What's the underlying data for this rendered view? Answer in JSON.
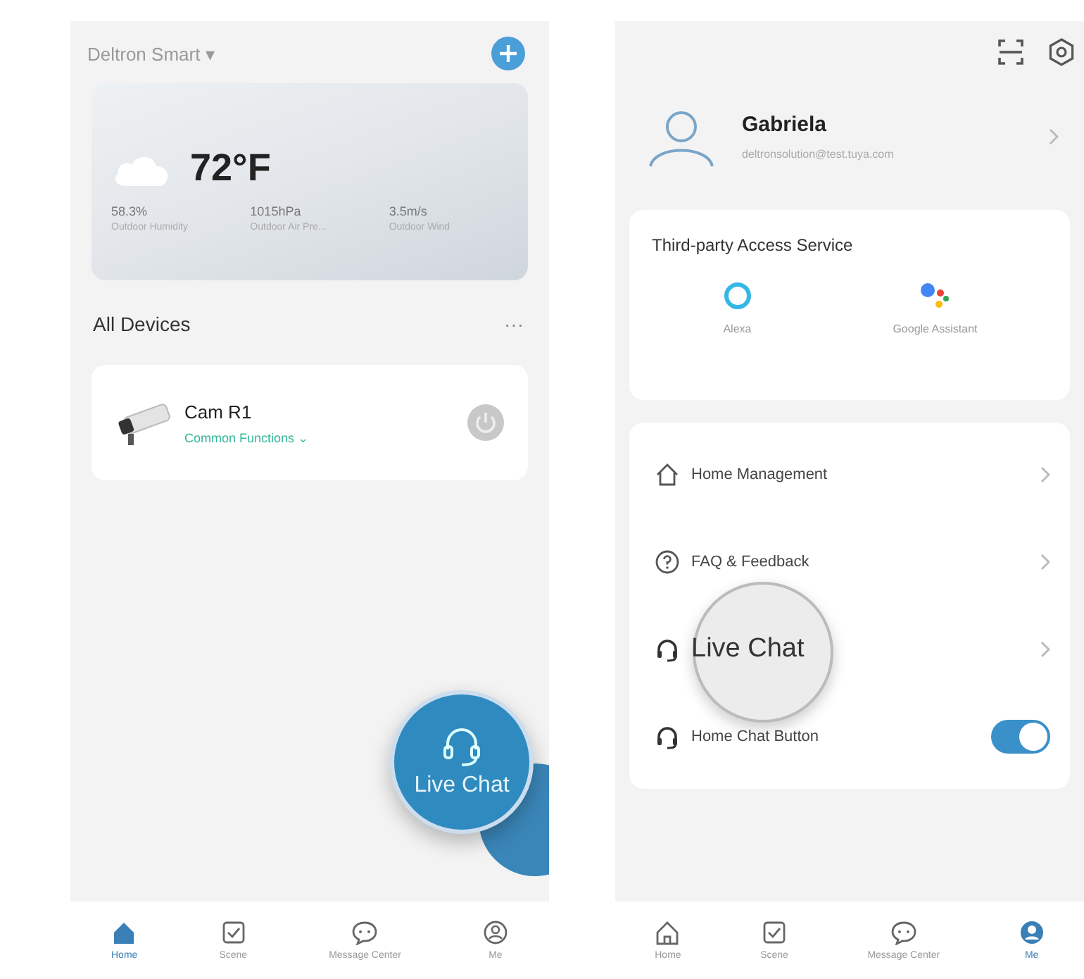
{
  "home_screen": {
    "home_name": "Deltron Smart ▾",
    "weather": {
      "temperature": "72°F",
      "stats": [
        {
          "value": "58.3%",
          "label": "Outdoor Humidity"
        },
        {
          "value": "1015hPa",
          "label": "Outdoor Air Pre..."
        },
        {
          "value": "3.5m/s",
          "label": "Outdoor Wind"
        }
      ]
    },
    "section_title": "All Devices",
    "more": "···",
    "devices": [
      {
        "name": "Cam R1",
        "functions": "Common Functions ⌄"
      }
    ],
    "live_chat_button": "Live Chat",
    "tabs": [
      {
        "label": "Home",
        "selected": true,
        "kind": "home"
      },
      {
        "label": "Scene",
        "selected": false,
        "kind": "scene"
      },
      {
        "label": "Message Center",
        "selected": false,
        "kind": "message"
      },
      {
        "label": "Me",
        "selected": false,
        "kind": "me"
      }
    ]
  },
  "me_screen": {
    "profile": {
      "name": "Gabriela",
      "email": "deltronsolution@test.tuya.com"
    },
    "third_party": {
      "title": "Third-party Access Service",
      "services": [
        {
          "label": "Alexa",
          "kind": "alexa"
        },
        {
          "label": "Google Assistant",
          "kind": "google"
        }
      ]
    },
    "menu": [
      {
        "label": "Home Management",
        "kind": "management",
        "magnified": false
      },
      {
        "label": "FAQ & Feedback",
        "kind": "faq",
        "magnified": false
      },
      {
        "label": "Live Chat",
        "kind": "chat",
        "magnified": true
      },
      {
        "label": "Home Chat Button",
        "kind": "toggle",
        "on": true,
        "magnified": false
      }
    ],
    "tabs": [
      {
        "label": "Home",
        "selected": false,
        "kind": "home"
      },
      {
        "label": "Scene",
        "selected": false,
        "kind": "scene"
      },
      {
        "label": "Message Center",
        "selected": false,
        "kind": "message"
      },
      {
        "label": "Me",
        "selected": true,
        "kind": "me"
      }
    ]
  }
}
